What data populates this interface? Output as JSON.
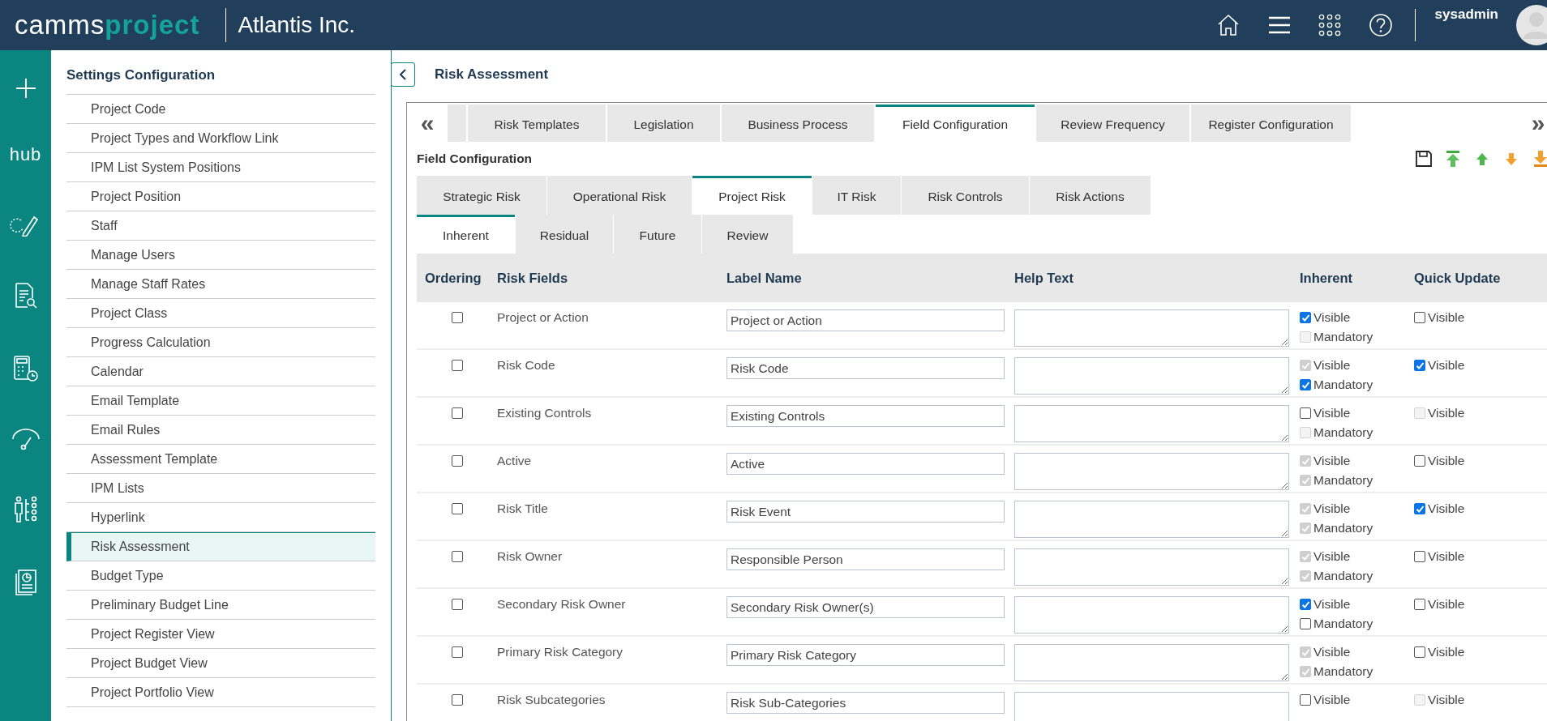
{
  "header": {
    "logo_left": "camms",
    "logo_right": "project",
    "company": "Atlantis Inc.",
    "user": "sysadmin"
  },
  "rail": {
    "hub_label": "hub"
  },
  "sidebar": {
    "title": "Settings Configuration",
    "items": [
      {
        "label": "Project Code",
        "selected": false
      },
      {
        "label": "Project Types and Workflow Link",
        "selected": false
      },
      {
        "label": "IPM List System Positions",
        "selected": false
      },
      {
        "label": "Project Position",
        "selected": false
      },
      {
        "label": "Staff",
        "selected": false
      },
      {
        "label": "Manage Users",
        "selected": false
      },
      {
        "label": "Manage Staff Rates",
        "selected": false
      },
      {
        "label": "Project Class",
        "selected": false
      },
      {
        "label": "Progress Calculation",
        "selected": false
      },
      {
        "label": "Calendar",
        "selected": false
      },
      {
        "label": "Email Template",
        "selected": false
      },
      {
        "label": "Email Rules",
        "selected": false
      },
      {
        "label": "Assessment Template",
        "selected": false
      },
      {
        "label": "IPM Lists",
        "selected": false
      },
      {
        "label": "Hyperlink",
        "selected": false
      },
      {
        "label": "Risk Assessment",
        "selected": true
      },
      {
        "label": "Budget Type",
        "selected": false
      },
      {
        "label": "Preliminary Budget Line",
        "selected": false
      },
      {
        "label": "Project Register View",
        "selected": false
      },
      {
        "label": "Project Budget View",
        "selected": false
      },
      {
        "label": "Project Portfolio View",
        "selected": false
      }
    ]
  },
  "page_title": "Risk Assessment",
  "top_tabs": {
    "prev": "«",
    "next": "»",
    "items": [
      {
        "label": "Risk Templates",
        "selected": false
      },
      {
        "label": "Legislation",
        "selected": false
      },
      {
        "label": "Business Process",
        "selected": false
      },
      {
        "label": "Field Configuration",
        "selected": true
      },
      {
        "label": "Review Frequency",
        "selected": false
      },
      {
        "label": "Register Configuration",
        "selected": false
      }
    ]
  },
  "section_title": "Field Configuration",
  "risk_tabs": [
    {
      "label": "Strategic Risk",
      "selected": false
    },
    {
      "label": "Operational Risk",
      "selected": false
    },
    {
      "label": "Project Risk",
      "selected": true
    },
    {
      "label": "IT Risk",
      "selected": false
    },
    {
      "label": "Risk Controls",
      "selected": false
    },
    {
      "label": "Risk Actions",
      "selected": false
    }
  ],
  "phase_tabs": [
    {
      "label": "Inherent",
      "selected": true
    },
    {
      "label": "Residual",
      "selected": false
    },
    {
      "label": "Future",
      "selected": false
    },
    {
      "label": "Review",
      "selected": false
    }
  ],
  "table": {
    "columns": [
      "Ordering",
      "Risk Fields",
      "Label Name",
      "Help Text",
      "Inherent",
      "Quick Update"
    ],
    "rows": [
      {
        "ordering": {
          "checked": false
        },
        "field": "Project or Action",
        "label_name": "Project or Action",
        "visible": {
          "label": "Visible",
          "checked": true,
          "disabled": false
        },
        "mandatory": {
          "label": "Mandatory",
          "checked": false,
          "disabled": true
        },
        "quick_update": {
          "label": "Visible",
          "checked": false,
          "disabled": false
        }
      },
      {
        "ordering": {
          "checked": false
        },
        "field": "Risk Code",
        "label_name": "Risk Code",
        "visible": {
          "label": "Visible",
          "checked": true,
          "disabled": true
        },
        "mandatory": {
          "label": "Mandatory",
          "checked": true,
          "disabled": false
        },
        "quick_update": {
          "label": "Visible",
          "checked": true,
          "disabled": false
        }
      },
      {
        "ordering": {
          "checked": false
        },
        "field": "Existing Controls",
        "label_name": "Existing Controls",
        "visible": {
          "label": "Visible",
          "checked": false,
          "disabled": false
        },
        "mandatory": {
          "label": "Mandatory",
          "checked": false,
          "disabled": true
        },
        "quick_update": {
          "label": "Visible",
          "checked": false,
          "disabled": true
        }
      },
      {
        "ordering": {
          "checked": false
        },
        "field": "Active",
        "label_name": "Active",
        "visible": {
          "label": "Visible",
          "checked": true,
          "disabled": true
        },
        "mandatory": {
          "label": "Mandatory",
          "checked": true,
          "disabled": true
        },
        "quick_update": {
          "label": "Visible",
          "checked": false,
          "disabled": false
        }
      },
      {
        "ordering": {
          "checked": false
        },
        "field": "Risk Title",
        "label_name": "Risk Event",
        "visible": {
          "label": "Visible",
          "checked": true,
          "disabled": true
        },
        "mandatory": {
          "label": "Mandatory",
          "checked": true,
          "disabled": true
        },
        "quick_update": {
          "label": "Visible",
          "checked": true,
          "disabled": false
        }
      },
      {
        "ordering": {
          "checked": false
        },
        "field": "Risk Owner",
        "label_name": "Responsible Person",
        "visible": {
          "label": "Visible",
          "checked": true,
          "disabled": true
        },
        "mandatory": {
          "label": "Mandatory",
          "checked": true,
          "disabled": true
        },
        "quick_update": {
          "label": "Visible",
          "checked": false,
          "disabled": false
        }
      },
      {
        "ordering": {
          "checked": false
        },
        "field": "Secondary Risk Owner",
        "label_name": "Secondary Risk Owner(s)",
        "visible": {
          "label": "Visible",
          "checked": true,
          "disabled": false
        },
        "mandatory": {
          "label": "Mandatory",
          "checked": false,
          "disabled": false
        },
        "quick_update": {
          "label": "Visible",
          "checked": false,
          "disabled": false
        }
      },
      {
        "ordering": {
          "checked": false
        },
        "field": "Primary Risk Category",
        "label_name": "Primary Risk Category",
        "visible": {
          "label": "Visible",
          "checked": true,
          "disabled": true
        },
        "mandatory": {
          "label": "Mandatory",
          "checked": true,
          "disabled": true
        },
        "quick_update": {
          "label": "Visible",
          "checked": false,
          "disabled": false
        }
      },
      {
        "ordering": {
          "checked": false
        },
        "field": "Risk Subcategories",
        "label_name": "Risk Sub-Categories",
        "visible": {
          "label": "Visible",
          "checked": false,
          "disabled": false
        },
        "quick_update": {
          "label": "Visible",
          "checked": false,
          "disabled": true
        }
      }
    ]
  }
}
